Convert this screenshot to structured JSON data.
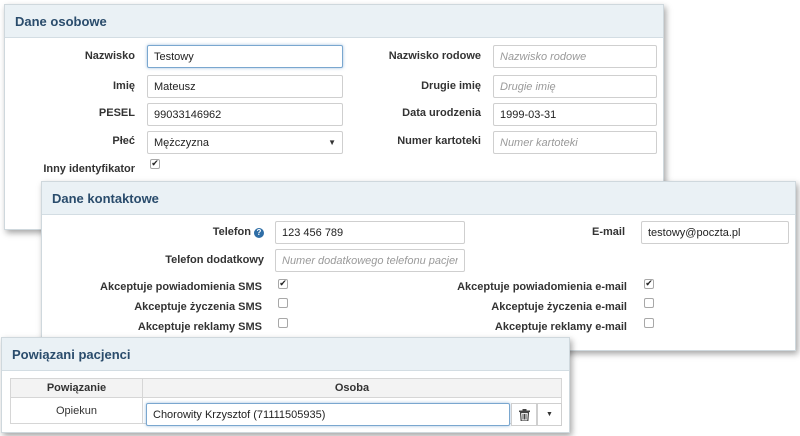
{
  "personal": {
    "title": "Dane osobowe",
    "surname_label": "Nazwisko",
    "surname_value": "Testowy",
    "first_name_label": "Imię",
    "first_name_value": "Mateusz",
    "pesel_label": "PESEL",
    "pesel_value": "99033146962",
    "sex_label": "Płeć",
    "sex_value": "Mężczyzna",
    "other_id_label": "Inny identyfikator",
    "other_id_checked": true,
    "family_name_label": "Nazwisko rodowe",
    "family_name_placeholder": "Nazwisko rodowe",
    "second_name_label": "Drugie imię",
    "second_name_placeholder": "Drugie imię",
    "birth_date_label": "Data urodzenia",
    "birth_date_value": "1999-03-31",
    "card_number_label": "Numer kartoteki",
    "card_number_placeholder": "Numer kartoteki"
  },
  "contact": {
    "title": "Dane kontaktowe",
    "phone_label": "Telefon",
    "phone_help_icon": "help-icon",
    "phone_value": "123 456 789",
    "extra_phone_label": "Telefon dodatkowy",
    "extra_phone_placeholder": "Numer dodatkowego telefonu pacjenta",
    "email_label": "E-mail",
    "email_value": "testowy@poczta.pl",
    "sms_notifications_label": "Akceptuje powiadomienia SMS",
    "sms_notifications_checked": true,
    "sms_wishes_label": "Akceptuje życzenia SMS",
    "sms_wishes_checked": false,
    "sms_ads_label": "Akceptuje reklamy SMS",
    "sms_ads_checked": false,
    "email_notifications_label": "Akceptuje powiadomienia e-mail",
    "email_notifications_checked": true,
    "email_wishes_label": "Akceptuje życzenia e-mail",
    "email_wishes_checked": false,
    "email_ads_label": "Akceptuje reklamy e-mail",
    "email_ads_checked": false
  },
  "related": {
    "title": "Powiązani pacjenci",
    "col_relation": "Powiązanie",
    "col_person": "Osoba",
    "rows": [
      {
        "relation": "Opiekun",
        "person": "Chorowity Krzysztof (71111505935)"
      }
    ],
    "delete_icon": "trash-icon",
    "dropdown_icon": "chevron-down-icon"
  },
  "colors": {
    "header_bg": "#eaf1f5",
    "title_text": "#2a4c6c",
    "help_icon": "#2f6ea6"
  }
}
